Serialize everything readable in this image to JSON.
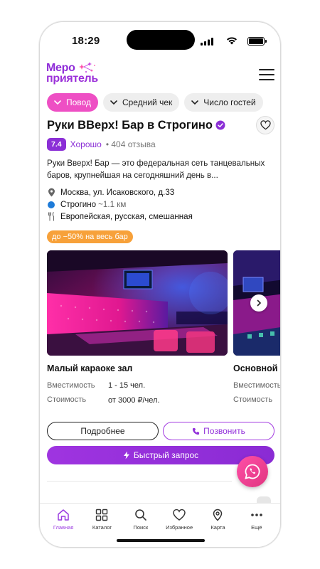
{
  "status_bar": {
    "time": "18:29"
  },
  "header": {
    "logo_line1": "Меро",
    "logo_line2": "приятель"
  },
  "filters": [
    {
      "label": "Повод",
      "active": true
    },
    {
      "label": "Средний чек",
      "active": false
    },
    {
      "label": "Число гостей",
      "active": false
    }
  ],
  "venue": {
    "title": "Руки ВВерх! Бар в Строгино",
    "rating": "7.4",
    "rating_label": "Хорошо",
    "reviews": "404 отзыва",
    "description": "Руки Вверх! Бар — это федеральная сеть танцевальных баров, крупнейшая на сегодняшний день в...",
    "address": "Москва, ул. Исаковского, д.33",
    "metro": "Строгино",
    "metro_distance": "~1.1 км",
    "cuisine": "Европейская, русская, смешанная",
    "promo": "до −50% на весь бар"
  },
  "halls": [
    {
      "name": "Малый караоке зал",
      "capacity_label": "Вместимость",
      "capacity": "1 - 15 чел.",
      "cost_label": "Стоимость",
      "cost": "от 3000 ₽/чел."
    },
    {
      "name": "Основной",
      "capacity_label": "Вместимость",
      "capacity": "",
      "cost_label": "Стоимость",
      "cost": ""
    }
  ],
  "actions": {
    "more": "Подробнее",
    "call": "Позвонить",
    "quick": "Быстрый запрос"
  },
  "tabbar": [
    {
      "label": "Главная",
      "icon": "home-icon",
      "active": true
    },
    {
      "label": "Каталог",
      "icon": "grid-icon",
      "active": false
    },
    {
      "label": "Поиск",
      "icon": "search-icon",
      "active": false
    },
    {
      "label": "Избранное",
      "icon": "heart-icon",
      "active": false
    },
    {
      "label": "Карта",
      "icon": "map-pin-icon",
      "active": false
    },
    {
      "label": "Ещё",
      "icon": "more-icon",
      "active": false
    }
  ],
  "colors": {
    "accent": "#8b2fd6",
    "chip_active": "#ee4fc4",
    "promo": "#f7a13a",
    "metro": "#1e7bd8",
    "whatsapp_button": "#e8408f"
  }
}
